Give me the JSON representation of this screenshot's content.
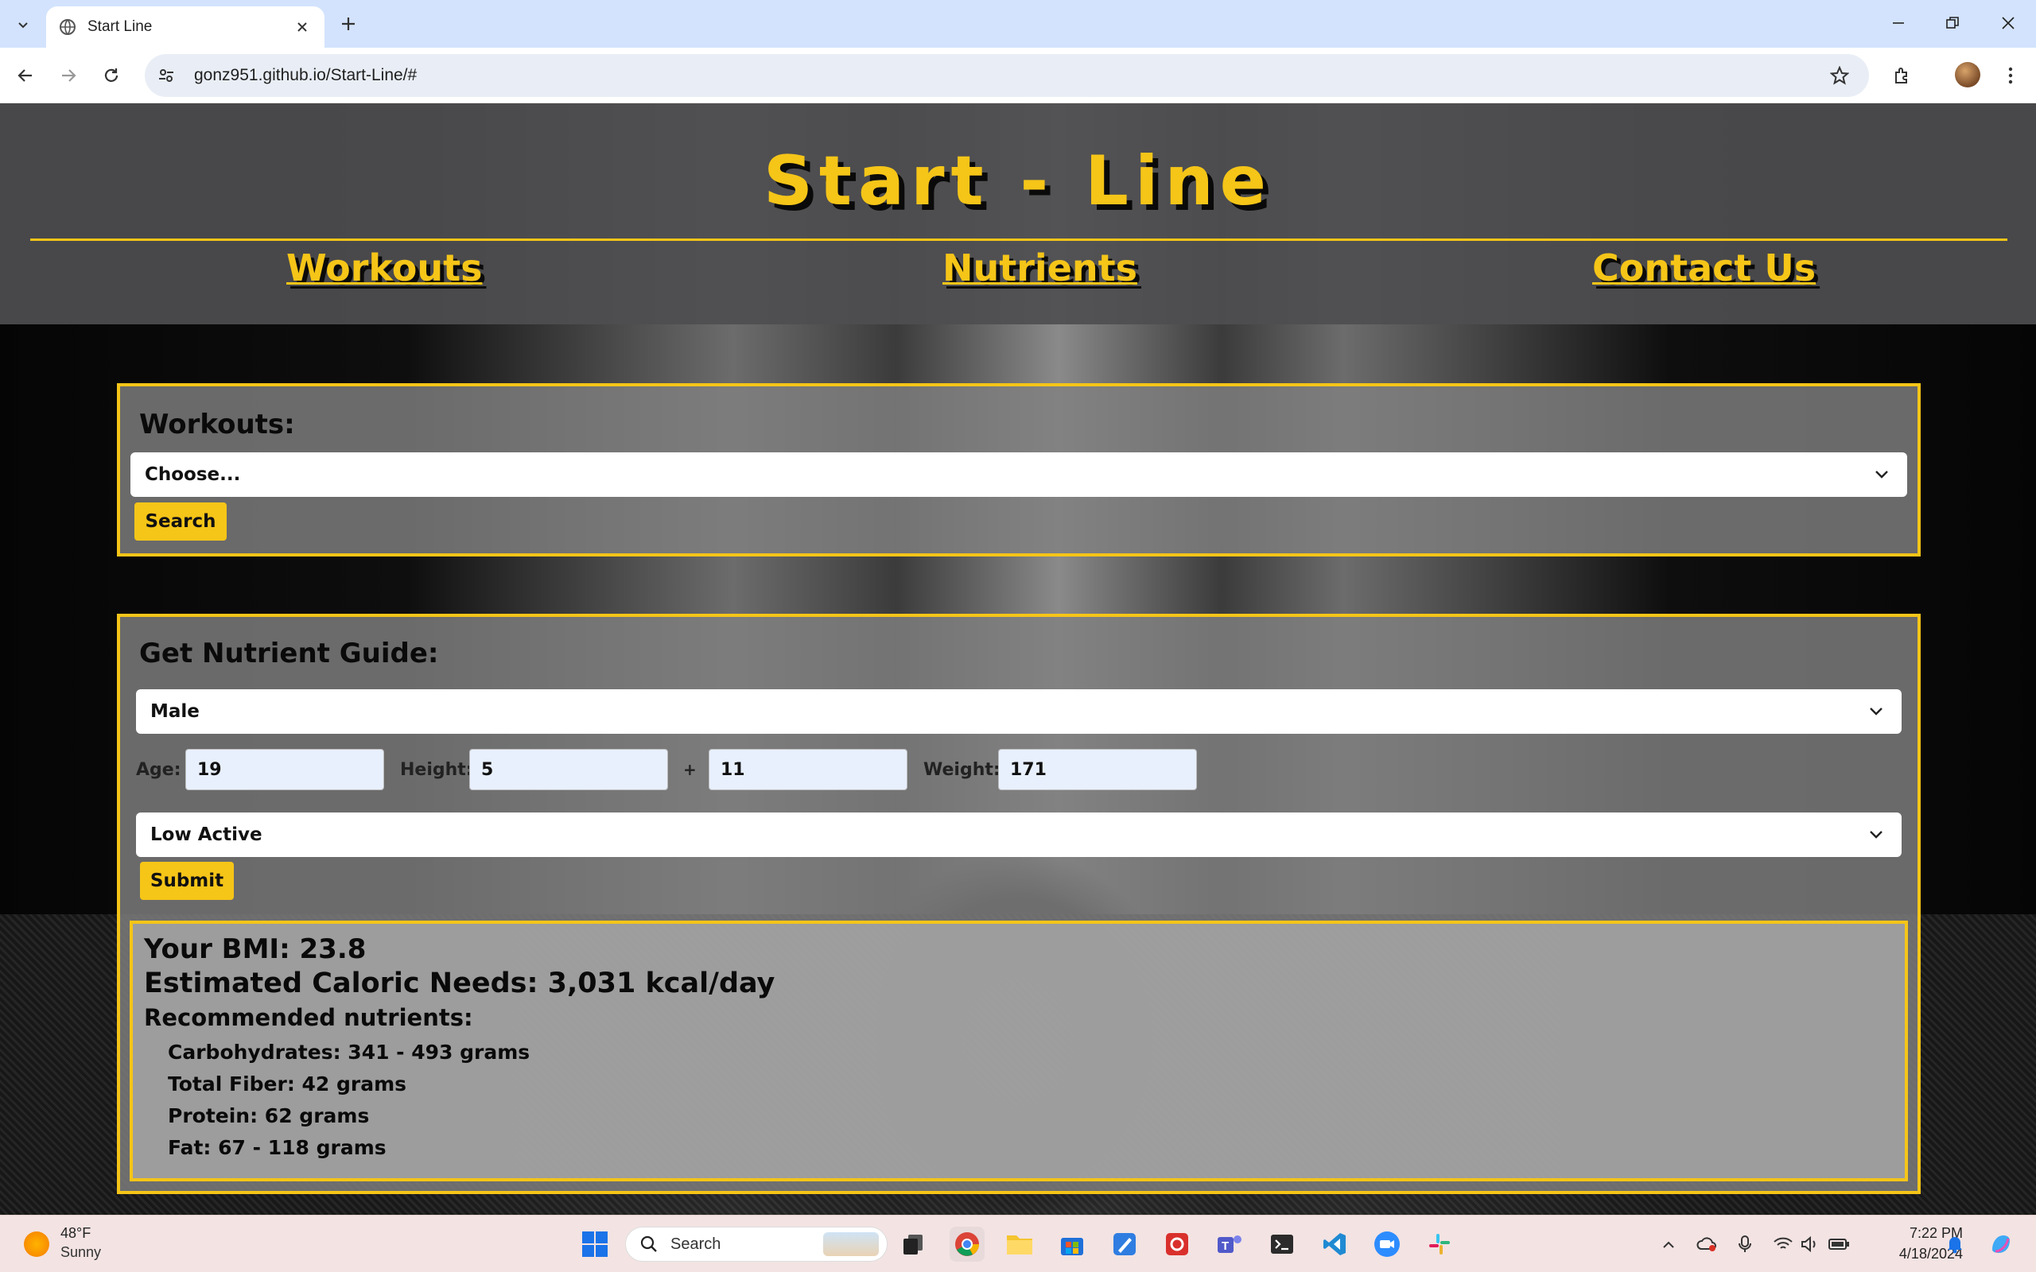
{
  "browser": {
    "tab_title": "Start Line",
    "url": "gonz951.github.io/Start-Line/#"
  },
  "site": {
    "title": "Start - Line",
    "nav": [
      "Workouts",
      "Nutrients",
      "Contact Us"
    ]
  },
  "workouts_panel": {
    "heading": "Workouts:",
    "select_value": "Choose...",
    "button": "Search"
  },
  "nutrient_panel": {
    "heading": "Get Nutrient Guide:",
    "sex_value": "Male",
    "age_label": "Age:",
    "age_value": "19",
    "height_label": "Height:",
    "height_ft": "5",
    "height_sep": "+",
    "height_in": "11",
    "weight_label": "Weight:",
    "weight_value": "171",
    "activity_value": "Low Active",
    "button": "Submit"
  },
  "results": {
    "bmi": "Your BMI: 23.8",
    "calories": "Estimated Caloric Needs: 3,031 kcal/day",
    "recommended": "Recommended nutrients:",
    "items": [
      "Carbohydrates: 341 - 493 grams",
      "Total Fiber: 42 grams",
      "Protein: 62 grams",
      "Fat: 67 - 118 grams"
    ]
  },
  "taskbar": {
    "temp": "48°F",
    "condition": "Sunny",
    "search": "Search",
    "time": "7:22 PM",
    "date": "4/18/2024"
  },
  "colors": {
    "accent": "#f5c518",
    "header_bg": "#4e4e50",
    "panel_bg": "#808080"
  }
}
